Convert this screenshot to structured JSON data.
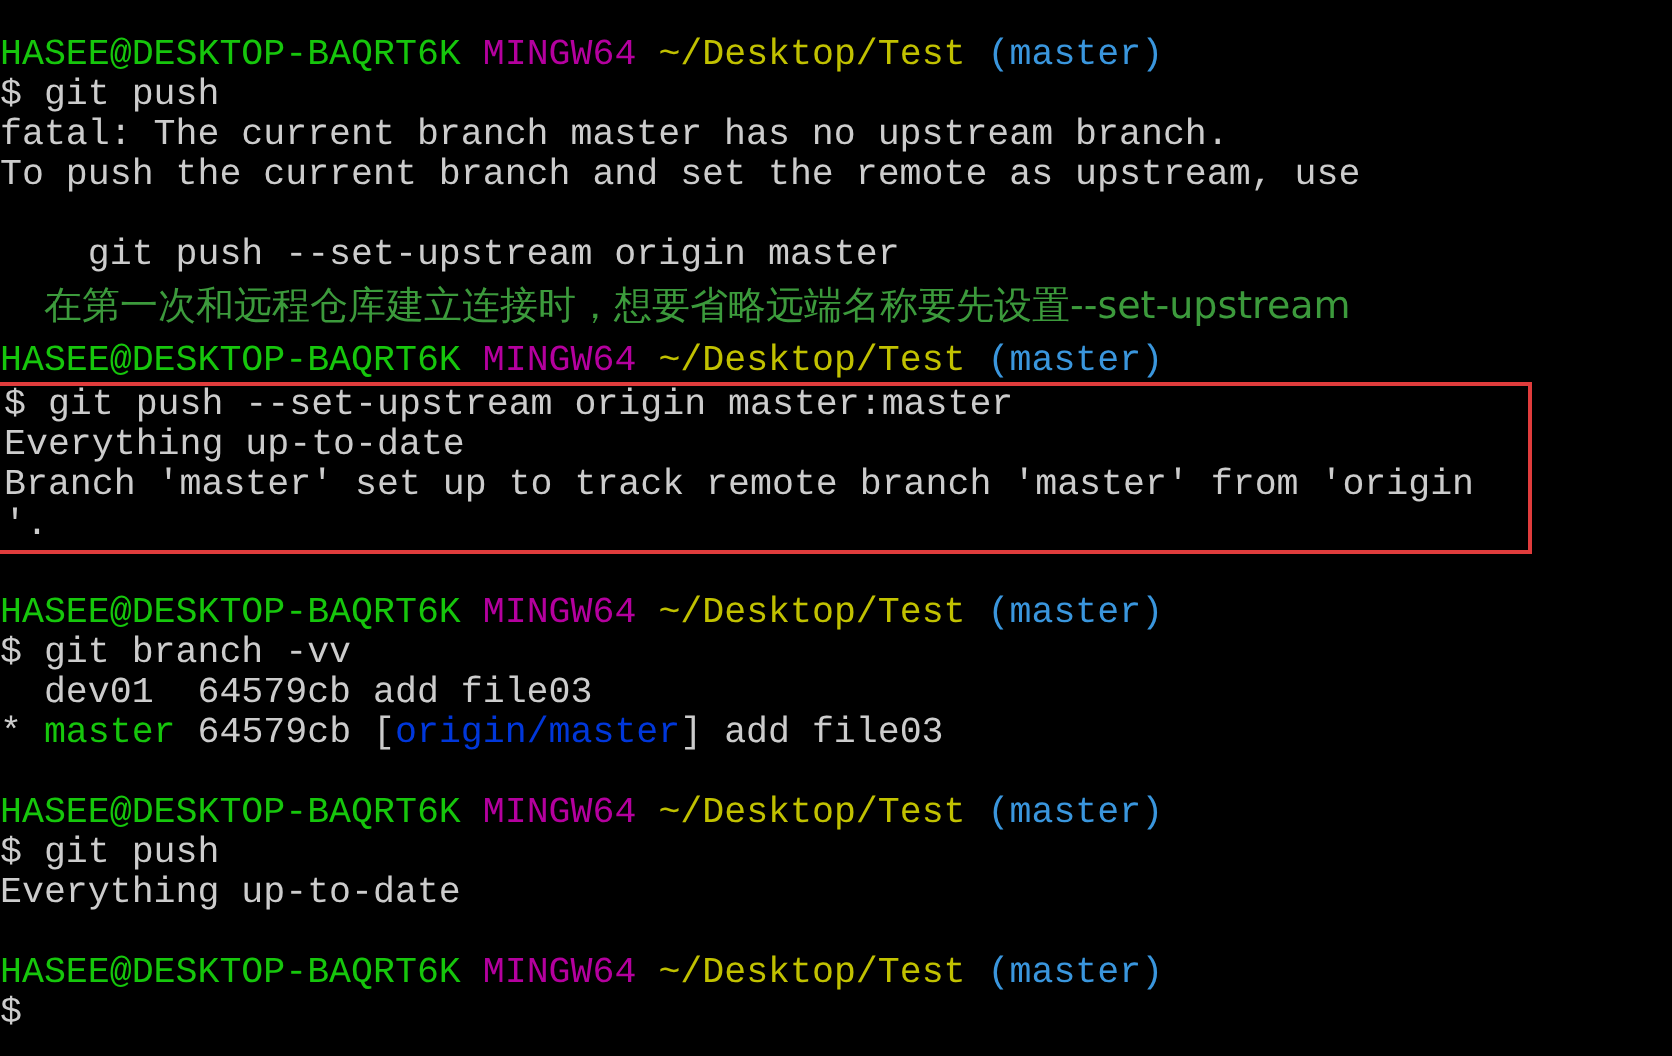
{
  "terminal": {
    "blocks": [
      {
        "highlighted": false,
        "lines": [
          {
            "kind": "prompt",
            "user": "HASEE@DESKTOP-BAQRT6K",
            "system": "MINGW64",
            "path": "~/Desktop/Test",
            "branch": "(master)"
          },
          {
            "kind": "command",
            "text": "$ git push"
          },
          {
            "kind": "output",
            "text": "fatal: The current branch master has no upstream branch."
          },
          {
            "kind": "output",
            "text": "To push the current branch and set the remote as upstream, use"
          },
          {
            "kind": "blank"
          },
          {
            "kind": "output",
            "text": "    git push --set-upstream origin master"
          },
          {
            "kind": "annotation",
            "text": "在第一次和远程仓库建立连接时，想要省略远端名称要先设置--set-upstream"
          },
          {
            "kind": "prompt",
            "user": "HASEE@DESKTOP-BAQRT6K",
            "system": "MINGW64",
            "path": "~/Desktop/Test",
            "branch": "(master)"
          }
        ]
      },
      {
        "highlighted": true,
        "lines": [
          {
            "kind": "command",
            "text": "$ git push --set-upstream origin master:master"
          },
          {
            "kind": "output",
            "text": "Everything up-to-date"
          },
          {
            "kind": "output",
            "text": "Branch 'master' set up to track remote branch 'master' from 'origin"
          },
          {
            "kind": "output",
            "text": "'."
          }
        ]
      },
      {
        "highlighted": false,
        "lines": [
          {
            "kind": "blank"
          },
          {
            "kind": "prompt",
            "user": "HASEE@DESKTOP-BAQRT6K",
            "system": "MINGW64",
            "path": "~/Desktop/Test",
            "branch": "(master)"
          },
          {
            "kind": "command",
            "text": "$ git branch -vv"
          },
          {
            "kind": "output",
            "text": "  dev01  64579cb add file03"
          },
          {
            "kind": "spans",
            "spans": [
              {
                "text": "* ",
                "color": "#cccccc"
              },
              {
                "text": "master",
                "color": "#16c60c"
              },
              {
                "text": " 64579cb [",
                "color": "#cccccc"
              },
              {
                "text": "origin/master",
                "color": "#0037da"
              },
              {
                "text": "] add file03",
                "color": "#cccccc"
              }
            ]
          },
          {
            "kind": "blank"
          },
          {
            "kind": "prompt",
            "user": "HASEE@DESKTOP-BAQRT6K",
            "system": "MINGW64",
            "path": "~/Desktop/Test",
            "branch": "(master)"
          },
          {
            "kind": "command",
            "text": "$ git push"
          },
          {
            "kind": "output",
            "text": "Everything up-to-date"
          },
          {
            "kind": "blank"
          },
          {
            "kind": "prompt",
            "user": "HASEE@DESKTOP-BAQRT6K",
            "system": "MINGW64",
            "path": "~/Desktop/Test",
            "branch": "(master)"
          },
          {
            "kind": "command",
            "text": "$"
          }
        ]
      }
    ]
  }
}
